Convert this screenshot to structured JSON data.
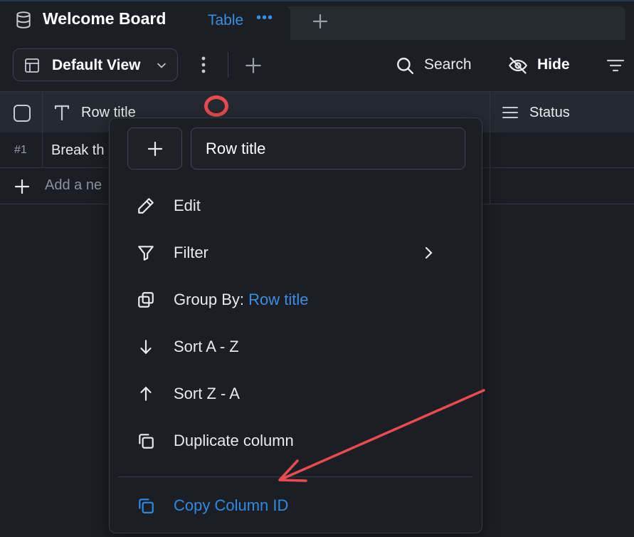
{
  "header": {
    "board_title": "Welcome Board",
    "active_tab": "Table",
    "tab_more": "•••"
  },
  "toolbar": {
    "view_label": "Default View",
    "search_label": "Search",
    "hide_label": "Hide"
  },
  "table": {
    "columns": [
      {
        "label": "Row title"
      },
      {
        "label": "Status"
      }
    ],
    "rows": [
      {
        "num": "#1",
        "title": "Break th"
      }
    ],
    "add_row_label": "Add a ne"
  },
  "context_menu": {
    "title_value": "Row title",
    "items": [
      {
        "label": "Edit"
      },
      {
        "label": "Filter"
      },
      {
        "label": "Group By: ",
        "value": "Row title"
      },
      {
        "label": "Sort A - Z"
      },
      {
        "label": "Sort Z - A"
      },
      {
        "label": "Duplicate column"
      },
      {
        "label": "Copy Column ID"
      }
    ]
  },
  "colors": {
    "accent": "#3b8fe2",
    "annotation": "#ea4a50",
    "background": "#1b1e24"
  }
}
